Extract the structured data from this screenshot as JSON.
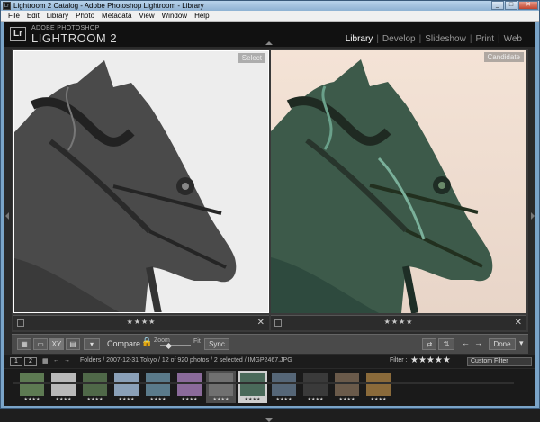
{
  "window": {
    "title": "Lightroom 2 Catalog - Adobe Photoshop Lightroom - Library"
  },
  "menu": [
    "File",
    "Edit",
    "Library",
    "Photo",
    "Metadata",
    "View",
    "Window",
    "Help"
  ],
  "identity": {
    "logo": "Lr",
    "brand_small": "ADOBE PHOTOSHOP",
    "brand_big": "LIGHTROOM 2"
  },
  "modules": [
    "Library",
    "Develop",
    "Slideshow",
    "Print",
    "Web"
  ],
  "active_module": "Library",
  "compare": {
    "select_label": "Select",
    "candidate_label": "Candidate",
    "select_stars": "★★★★",
    "candidate_stars": "★★★★"
  },
  "toolbar": {
    "compare_label": "Compare :",
    "zoom_label": "Zoom",
    "fit_label": "Fit",
    "sync_label": "Sync",
    "done_label": "Done",
    "view_icons": [
      "grid-view-icon",
      "loupe-view-icon",
      "compare-view-icon",
      "survey-view-icon"
    ]
  },
  "filmstrip_bar": {
    "monitor1": "1",
    "monitor2": "2",
    "path": "Folders / 2007-12-31 Tokyo / 12 of 920 photos / 2 selected / IMGP2467.JPG",
    "filter_label": "Filter :",
    "filter_stars": "★★★★★",
    "custom_filter": "Custom Filter"
  },
  "thumbnails": [
    {
      "stars": "★★★★",
      "color": "#5d7a52"
    },
    {
      "stars": "★★★★",
      "color": "#b9b9b9"
    },
    {
      "stars": "★★★★",
      "color": "#4f6848"
    },
    {
      "stars": "★★★★",
      "color": "#8aa0b8"
    },
    {
      "stars": "★★★★",
      "color": "#5a7a8a"
    },
    {
      "stars": "★★★★",
      "color": "#8a6a9a"
    },
    {
      "stars": "★★★★",
      "color": "#707070"
    },
    {
      "stars": "★★★★",
      "color": "#4a6a5a"
    },
    {
      "stars": "★★★★",
      "color": "#556677"
    },
    {
      "stars": "★★★★",
      "color": "#3a3a3a"
    },
    {
      "stars": "★★★★",
      "color": "#6a5a4a"
    },
    {
      "stars": "★★★★",
      "color": "#8a6a3a"
    }
  ]
}
